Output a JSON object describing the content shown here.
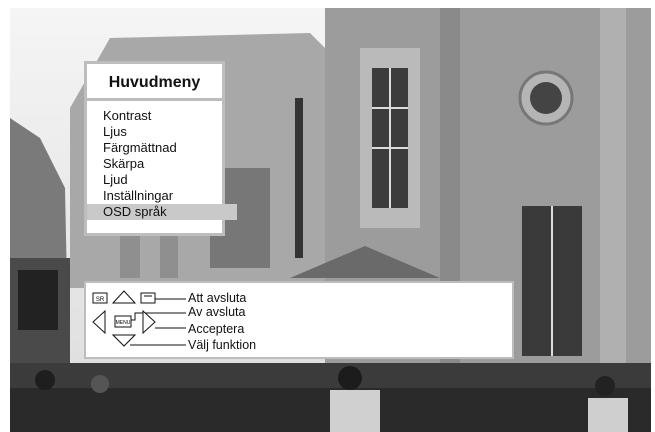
{
  "menu": {
    "title": "Huvudmeny",
    "items": [
      {
        "label": "Kontrast"
      },
      {
        "label": "Ljus"
      },
      {
        "label": "Färgmättnad"
      },
      {
        "label": "Skärpa"
      },
      {
        "label": "Ljud"
      },
      {
        "label": "Inställningar"
      },
      {
        "label": "OSD språk",
        "selected": true
      }
    ]
  },
  "help": {
    "sr_key": "SR",
    "menu_key": "MENU",
    "exit": "Att avsluta",
    "back": "Av avsluta",
    "accept": "Acceptera",
    "select": "Välj funktion"
  },
  "colors": {
    "panel_border": "#bdbdbd",
    "highlight": "#c9c9c9"
  }
}
